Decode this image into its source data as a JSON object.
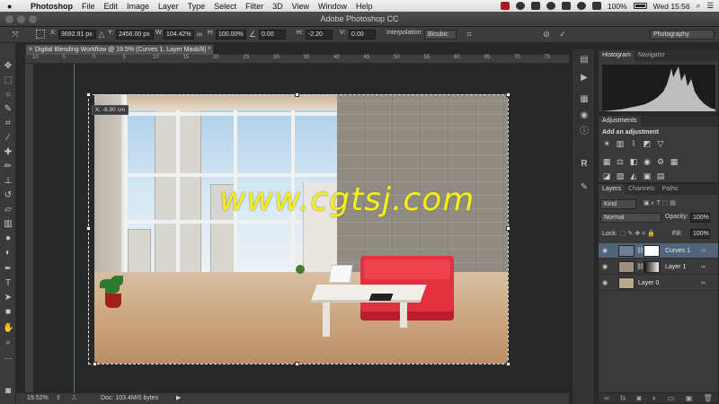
{
  "menubar": {
    "app": "Photoshop",
    "items": [
      "File",
      "Edit",
      "Image",
      "Layer",
      "Type",
      "Select",
      "Filter",
      "3D",
      "View",
      "Window",
      "Help"
    ],
    "battery": "100%",
    "clock": "Wed 15:56"
  },
  "window": {
    "title": "Adobe Photoshop CC"
  },
  "options": {
    "x_label": "X:",
    "x_value": "3692.91 px",
    "y_label": "Y:",
    "y_value": "2456.00 px",
    "w_label": "W:",
    "w_value": "104.42%",
    "h_label": "H:",
    "h_value": "100.00%",
    "angle_value": "0.00",
    "hskew_label": "H:",
    "hskew_value": "-2.20",
    "vskew_label": "V:",
    "vskew_value": "0.00",
    "interp_label": "Interpolation:",
    "interp_value": "Bicubic",
    "workspace": "Photography"
  },
  "document": {
    "tab_close": "×",
    "tab_title": "Digital Blending Workflow @ 19.5% (Curves 1, Layer Mask/8) *",
    "tooltip": "X: -6.90 cm",
    "watermark": "www.cgtsj.com"
  },
  "ruler": {
    "h_ticks": [
      "10",
      "5",
      "0",
      "5",
      "10",
      "15",
      "20",
      "25",
      "30",
      "35",
      "40",
      "45",
      "50",
      "55",
      "60",
      "65",
      "70",
      "75"
    ]
  },
  "status": {
    "zoom": "19.52%",
    "doc": "Doc: 103.4M/0 bytes",
    "arrow": "▶"
  },
  "panels": {
    "histogram_tabs": [
      "Histogram",
      "Navigator"
    ],
    "adjustments_tab": "Adjustments",
    "adjustments_title": "Add an adjustment",
    "layers_tabs": [
      "Layers",
      "Channels",
      "Paths"
    ],
    "kind_label": "Kind",
    "blend_mode": "Normal",
    "opacity_label": "Opacity:",
    "opacity_value": "100%",
    "lock_label": "Lock:",
    "fill_label": "Fill:",
    "fill_value": "100%",
    "layers": [
      {
        "name": "Curves 1",
        "selected": true
      },
      {
        "name": "Layer 1",
        "selected": false
      },
      {
        "name": "Layer 0",
        "selected": false
      }
    ]
  },
  "colors": {
    "accent": "#52647a",
    "watermark": "#f6f010",
    "sofa": "#e2303f"
  },
  "icons": [
    "apple-icon",
    "move-tool-icon",
    "marquee-icon",
    "lasso-icon",
    "quick-select-icon",
    "crop-icon",
    "eyedropper-icon",
    "healing-icon",
    "brush-icon",
    "stamp-icon",
    "history-brush-icon",
    "eraser-icon",
    "gradient-icon",
    "blur-icon",
    "dodge-icon",
    "pen-icon",
    "type-icon",
    "path-select-icon",
    "rectangle-icon",
    "hand-icon",
    "zoom-icon"
  ]
}
